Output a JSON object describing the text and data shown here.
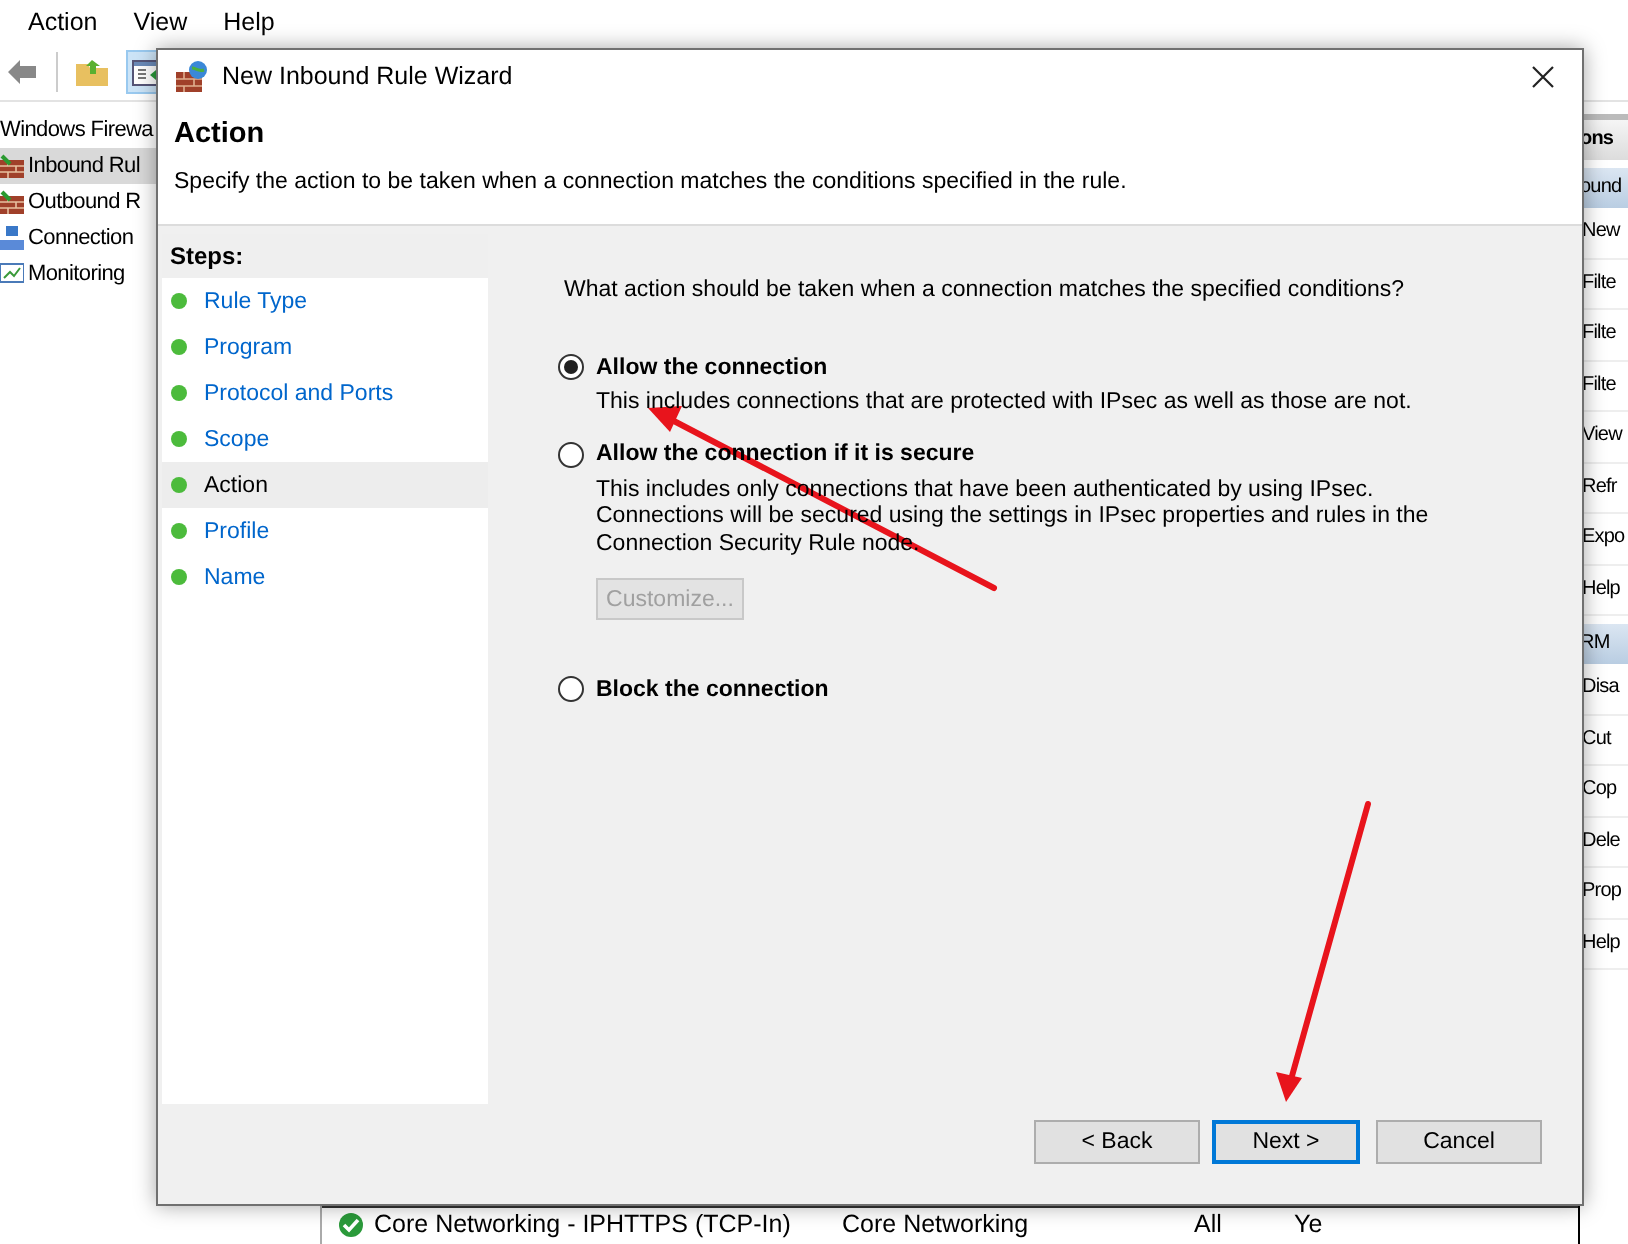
{
  "menu": [
    "Action",
    "View",
    "Help"
  ],
  "tree": {
    "title": "Windows Firewa",
    "items": [
      {
        "label": "Inbound Rul",
        "selected": true
      },
      {
        "label": "Outbound R",
        "selected": false
      },
      {
        "label": "Connection",
        "selected": false
      },
      {
        "label": "Monitoring",
        "selected": false
      }
    ]
  },
  "actions_pane": {
    "header": "ons",
    "sections": [
      {
        "title": "ound",
        "items": [
          "New",
          "Filte",
          "Filte",
          "Filte",
          "View",
          "Refr",
          "Expo",
          "Help"
        ]
      },
      {
        "title": "RM",
        "items": [
          "Disa",
          "Cut",
          "Cop",
          "Dele",
          "Prop",
          "Help"
        ]
      }
    ]
  },
  "rule_list": {
    "rows": [
      {
        "cells": [
          "Core Networking - IPHTTPS (TCP-In)",
          "Core Networking",
          "All",
          "Ye"
        ]
      }
    ]
  },
  "dialog": {
    "title": "New Inbound Rule Wizard",
    "heading": "Action",
    "subtitle": "Specify the action to be taken when a connection matches the conditions specified in the rule.",
    "steps_title": "Steps:",
    "steps": [
      {
        "label": "Rule Type",
        "selected": false
      },
      {
        "label": "Program",
        "selected": false
      },
      {
        "label": "Protocol and Ports",
        "selected": false
      },
      {
        "label": "Scope",
        "selected": false
      },
      {
        "label": "Action",
        "selected": true
      },
      {
        "label": "Profile",
        "selected": false
      },
      {
        "label": "Name",
        "selected": false
      }
    ],
    "question": "What action should be taken when a connection matches the specified conditions?",
    "options": [
      {
        "label": "Allow the connection",
        "description": "This includes connections that are protected with IPsec as well as those are not.",
        "selected": true
      },
      {
        "label": "Allow the connection if it is secure",
        "description": "This includes only connections that have been authenticated by using IPsec.  Connections will be secured using the settings in IPsec properties and rules in the Connection Security Rule node.",
        "selected": false,
        "button": {
          "label": "Customize...",
          "disabled": true
        }
      },
      {
        "label": "Block the connection",
        "selected": false
      }
    ],
    "buttons": [
      {
        "label": "< Back",
        "default": false
      },
      {
        "label": "Next >",
        "default": true
      },
      {
        "label": "Cancel",
        "default": false
      }
    ]
  }
}
